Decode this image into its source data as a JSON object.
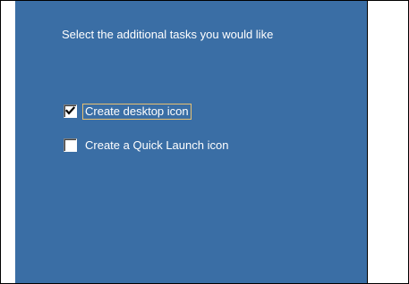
{
  "wizard": {
    "instruction": "Select the additional tasks you would like",
    "tasks": [
      {
        "label": "Create desktop icon",
        "checked": true,
        "focused": true
      },
      {
        "label": "Create a Quick Launch icon",
        "checked": false,
        "focused": false
      }
    ]
  },
  "colors": {
    "panel_background": "#3A6EA5",
    "text": "#FFFFFF",
    "focus_outline": "#E8C070"
  }
}
